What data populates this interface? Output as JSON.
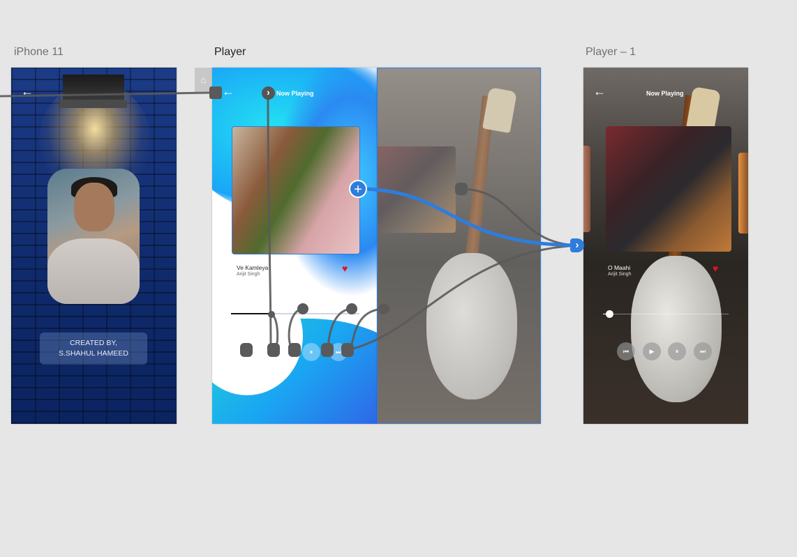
{
  "artboards": {
    "iphone": {
      "label": "iPhone 11",
      "credit_line1": "CREATED BY,",
      "credit_line2": "S.SHAHUL HAMEED",
      "back_icon": "←"
    },
    "player": {
      "label": "Player",
      "header": "Now Playing",
      "song": "Ve Kamleya",
      "artist": "Arijit Singh",
      "back_icon": "←",
      "heart_icon": "♥"
    },
    "player1": {
      "label": "Player – 1",
      "header": "Now Playing",
      "song": "O Maahi",
      "artist": "Arijit Singh",
      "back_icon": "←",
      "heart_icon": "♥"
    }
  },
  "controls": {
    "prev": "⏮",
    "play": "▶",
    "pause": "⏸",
    "next": "⏭"
  },
  "canvas": {
    "home_icon": "⌂",
    "add_icon": "+",
    "arrow_icon": "›"
  },
  "colors": {
    "wire": "#5a5a5a",
    "wire_active": "#2e7ddc",
    "heart": "#e0141e",
    "selection": "#2e7ddc"
  },
  "progress": {
    "player": 0.3,
    "player1": 0.05
  }
}
